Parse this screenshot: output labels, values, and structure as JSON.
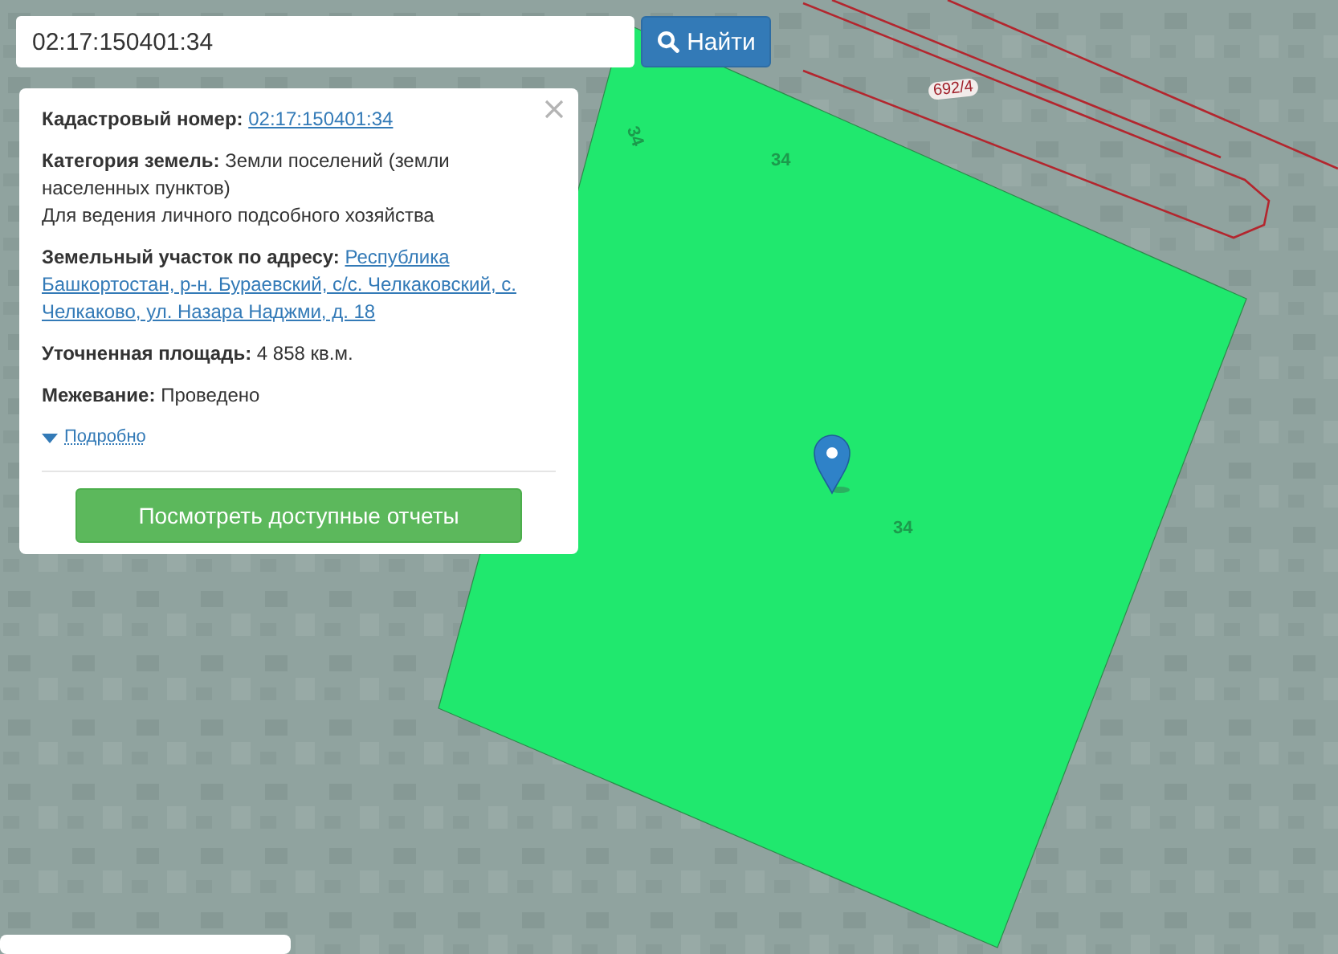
{
  "search": {
    "value": "02:17:150401:34",
    "button": "Найти"
  },
  "popup": {
    "fields": [
      {
        "kind": "link",
        "label": "Кадастровый номер:",
        "value": "02:17:150401:34"
      },
      {
        "kind": "text",
        "label": "Категория земель:",
        "value": "Земли поселений (земли населенных пунктов)",
        "note": "Для ведения личного подсобного хозяйства"
      },
      {
        "kind": "link",
        "label": "Земельный участок по адресу:",
        "value": "Республика",
        "more_lines": [
          "Башкортостан, р-н. Бураевский, с/с. Челкаковский, с.",
          "Челкаково, ул. Назара Наджми, д. 18"
        ]
      },
      {
        "kind": "text",
        "label": "Уточненная площадь:",
        "value": "4 858 кв.м."
      },
      {
        "kind": "text",
        "label": "Межевание:",
        "value": "Проведено"
      }
    ],
    "details_link": "Подробно",
    "expanded": false,
    "action_button": "Посмотреть доступные отчеты"
  },
  "map": {
    "parcel_labels": [
      "34",
      "34",
      "34"
    ],
    "road_label": "692/4"
  }
}
